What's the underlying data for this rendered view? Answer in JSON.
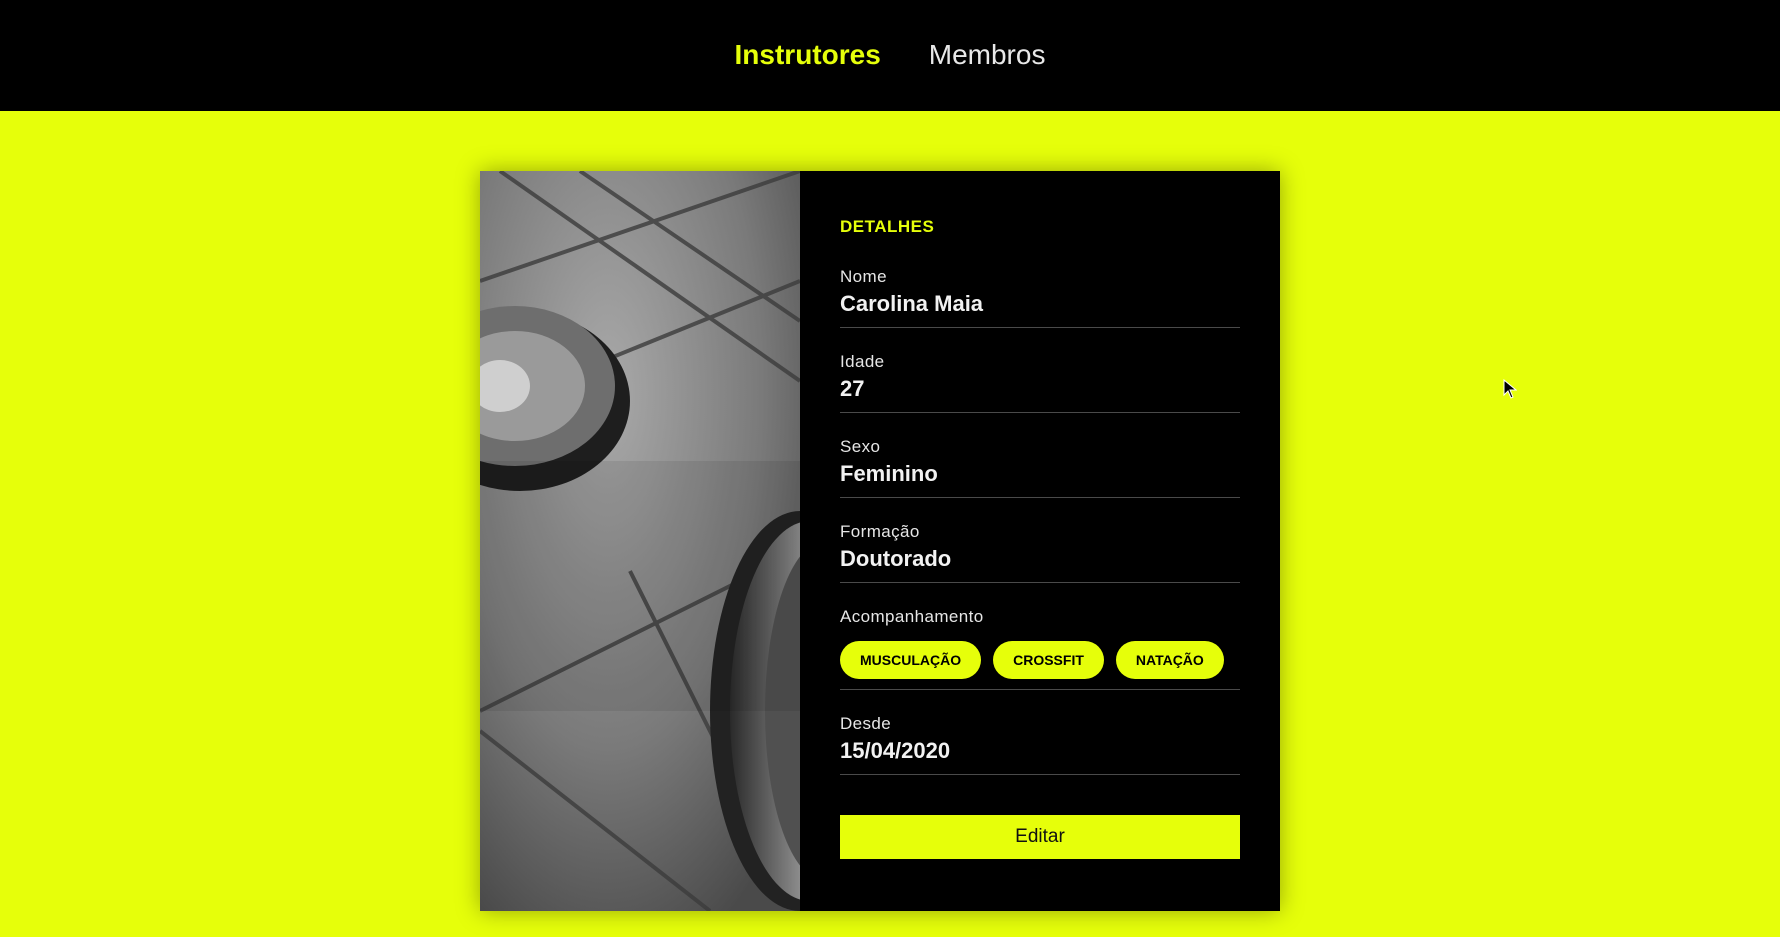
{
  "nav": {
    "items": [
      {
        "label": "Instrutores",
        "active": true
      },
      {
        "label": "Membros",
        "active": false
      }
    ]
  },
  "card": {
    "section_title": "DETALHES",
    "fields": {
      "nome": {
        "label": "Nome",
        "value": "Carolina Maia"
      },
      "idade": {
        "label": "Idade",
        "value": "27"
      },
      "sexo": {
        "label": "Sexo",
        "value": "Feminino"
      },
      "formacao": {
        "label": "Formação",
        "value": "Doutorado"
      },
      "acompanhamento": {
        "label": "Acompanhamento",
        "tags": [
          "MUSCULAÇÃO",
          "CROSSFIT",
          "NATAÇÃO"
        ]
      },
      "desde": {
        "label": "Desde",
        "value": "15/04/2020"
      }
    },
    "edit_label": "Editar",
    "photo_icon": "gym-weight-plates-photo"
  },
  "colors": {
    "accent": "#e6ff0a",
    "background": "#e6ff0a",
    "bar": "#000000",
    "card": "#000000"
  }
}
